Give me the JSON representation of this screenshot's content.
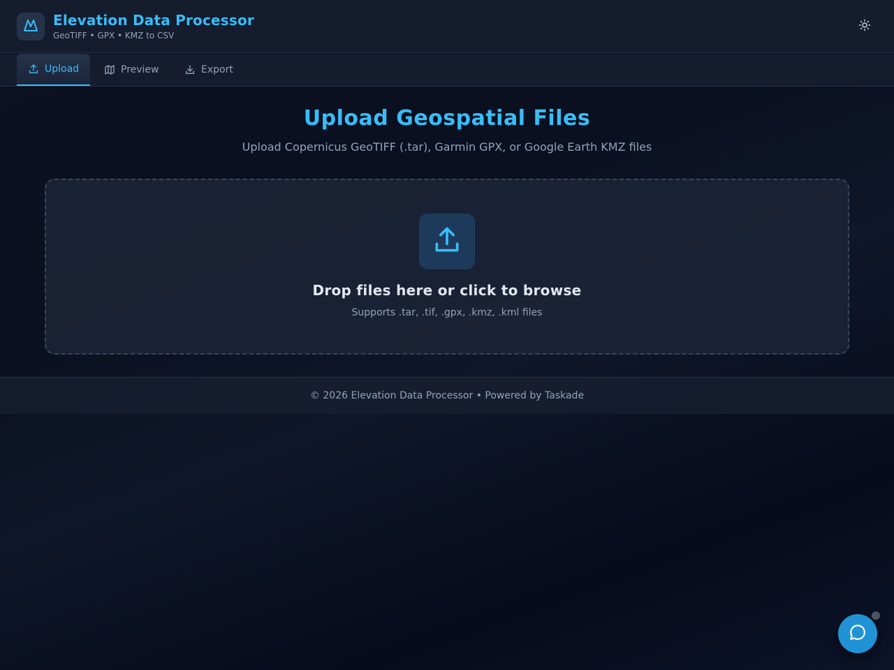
{
  "app": {
    "title": "Elevation Data Processor",
    "subtitle": "GeoTIFF • GPX • KMZ to CSV",
    "logo_icon": "mountain-icon",
    "theme_icon": "sun-icon"
  },
  "tabs": [
    {
      "label": "Upload",
      "icon": "upload-icon",
      "active": true
    },
    {
      "label": "Preview",
      "icon": "map-icon",
      "active": false
    },
    {
      "label": "Export",
      "icon": "download-icon",
      "active": false
    }
  ],
  "main": {
    "title": "Upload Geospatial Files",
    "subtitle": "Upload Copernicus GeoTIFF (.tar), Garmin GPX, or Google Earth KMZ files"
  },
  "dropzone": {
    "icon": "upload-icon",
    "title": "Drop files here or click to browse",
    "hint": "Supports .tar, .tif, .gpx, .kmz, .kml files"
  },
  "footer": {
    "text": "© 2026 Elevation Data Processor • Powered by Taskade"
  },
  "chat": {
    "icon": "chat-bubble-icon"
  },
  "colors": {
    "accent": "#38bdf8",
    "background": "#0c1222",
    "surface": "#1c2537",
    "muted_text": "#94a3b8",
    "chat_button": "#1f93d6"
  }
}
